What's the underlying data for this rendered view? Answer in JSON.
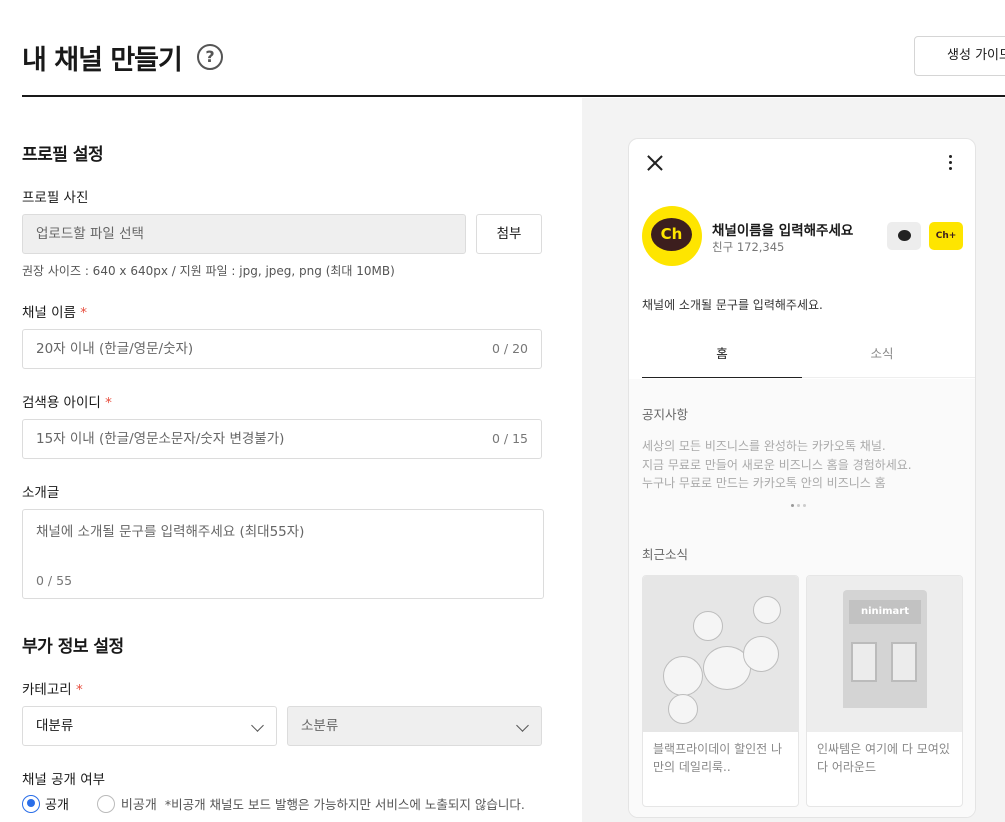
{
  "header": {
    "title": "내 채널 만들기",
    "help_icon": "?",
    "guide_button": "생성 가이드"
  },
  "profile": {
    "section_title": "프로필 설정",
    "photo_label": "프로필 사진",
    "upload_placeholder": "업로드할 파일 선택",
    "attach_button": "첨부",
    "hint": "권장 사이즈 : 640 x 640px / 지원 파일 : jpg, jpeg, png (최대 10MB)",
    "name_label": "채널 이름",
    "name_placeholder": "20자 이내 (한글/영문/숫자)",
    "name_counter": "0 / 20",
    "id_label": "검색용 아이디",
    "id_placeholder": "15자 이내 (한글/영문소문자/숫자 변경불가)",
    "id_counter": "0 / 15",
    "intro_label": "소개글",
    "intro_placeholder": "채널에 소개될 문구를 입력해주세요 (최대55자)",
    "intro_counter": "0 / 55",
    "required_mark": "*"
  },
  "extra": {
    "section_title": "부가 정보 설정",
    "category_label": "카테고리",
    "major_category": "대분류",
    "minor_category": "소분류",
    "visibility_label": "채널 공개 여부",
    "public_option": "공개",
    "private_option": "비공개",
    "private_note": "*비공개 채널도 보드 발행은 가능하지만 서비스에 노출되지 않습니다."
  },
  "preview": {
    "logo_text": "Ch",
    "channel_name": "채널이름을 입력해주세요",
    "friends": "친구 172,345",
    "add_label": "Ch+",
    "description": "채널에 소개될 문구를 입력해주세요.",
    "tab_home": "홈",
    "tab_news": "소식",
    "notice_heading": "공지사항",
    "notice_lines": [
      "세상의 모든 비즈니스를 완성하는 카카오톡 채널.",
      "지금 무료로 만들어 새로운 비즈니스 홈을 경험하세요.",
      "누구나 무료로 만드는 카카오톡 안의 비즈니스 홈"
    ],
    "recent_heading": "최근소식",
    "card1_text": "블랙프라이데이 할인전 나만의 데일리룩..",
    "card2_text": "인싸템은 여기에 다 모여있다 어라운드",
    "store_sign": "ninimart"
  },
  "colors": {
    "accent": "#2a6ee8",
    "kakao_yellow": "#fee500",
    "required": "#e74c3c"
  }
}
